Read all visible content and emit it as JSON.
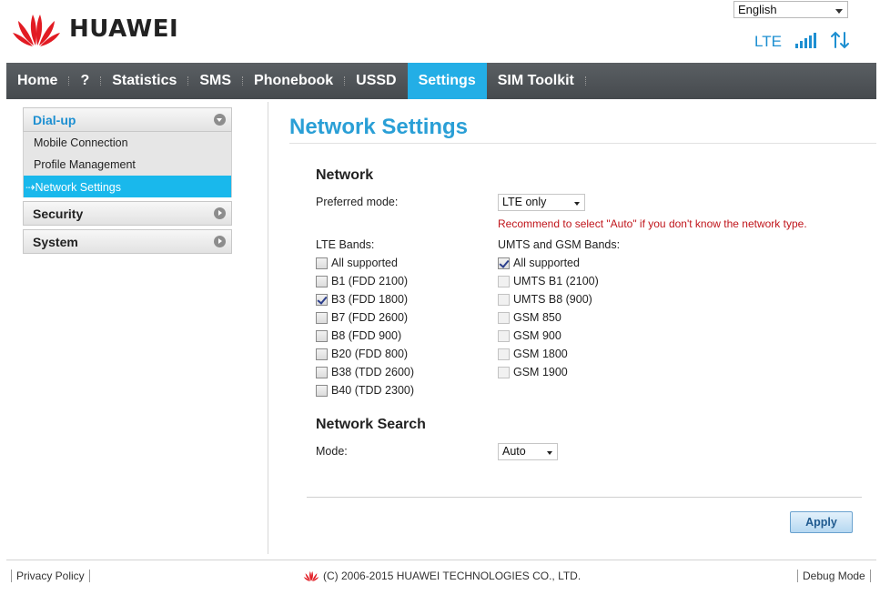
{
  "header": {
    "brand": "HUAWEI",
    "language": "English",
    "network_type": "LTE",
    "logo_color": "#e21b23",
    "accent_color": "#1d8fd1"
  },
  "nav": {
    "items": [
      {
        "label": "Home"
      },
      {
        "label": "?"
      },
      {
        "label": "Statistics"
      },
      {
        "label": "SMS"
      },
      {
        "label": "Phonebook"
      },
      {
        "label": "USSD"
      },
      {
        "label": "Settings",
        "active": true
      },
      {
        "label": "SIM Toolkit"
      }
    ]
  },
  "sidebar": {
    "groups": [
      {
        "label": "Dial-up",
        "expanded": true,
        "items": [
          {
            "label": "Mobile Connection"
          },
          {
            "label": "Profile Management"
          },
          {
            "label": "Network Settings",
            "active": true
          }
        ]
      },
      {
        "label": "Security",
        "expanded": false
      },
      {
        "label": "System",
        "expanded": false
      }
    ]
  },
  "main": {
    "title": "Network Settings",
    "network": {
      "heading": "Network",
      "preferred_mode_label": "Preferred mode:",
      "preferred_mode_value": "LTE only",
      "hint": "Recommend to select \"Auto\" if you don't know the network type.",
      "lte_label": "LTE Bands:",
      "lte_bands": [
        {
          "label": "All supported",
          "checked": false
        },
        {
          "label": "B1 (FDD 2100)",
          "checked": false
        },
        {
          "label": "B3 (FDD 1800)",
          "checked": true
        },
        {
          "label": "B7 (FDD 2600)",
          "checked": false
        },
        {
          "label": "B8 (FDD 900)",
          "checked": false
        },
        {
          "label": "B20 (FDD 800)",
          "checked": false
        },
        {
          "label": "B38 (TDD 2600)",
          "checked": false
        },
        {
          "label": "B40 (TDD 2300)",
          "checked": false
        }
      ],
      "umts_label": "UMTS and GSM Bands:",
      "umts_bands": [
        {
          "label": "All supported",
          "checked": true,
          "disabled": false
        },
        {
          "label": "UMTS B1 (2100)",
          "checked": false,
          "disabled": true
        },
        {
          "label": "UMTS B8 (900)",
          "checked": false,
          "disabled": true
        },
        {
          "label": "GSM 850",
          "checked": false,
          "disabled": true
        },
        {
          "label": "GSM 900",
          "checked": false,
          "disabled": true
        },
        {
          "label": "GSM 1800",
          "checked": false,
          "disabled": true
        },
        {
          "label": "GSM 1900",
          "checked": false,
          "disabled": true
        }
      ]
    },
    "search": {
      "heading": "Network Search",
      "mode_label": "Mode:",
      "mode_value": "Auto"
    },
    "apply_label": "Apply"
  },
  "footer": {
    "privacy": "Privacy Policy",
    "copyright": "(C) 2006-2015 HUAWEI TECHNOLOGIES CO., LTD.",
    "debug": "Debug Mode"
  }
}
